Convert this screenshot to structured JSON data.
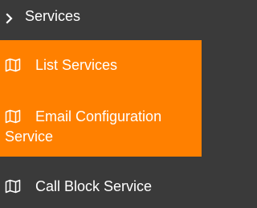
{
  "menu": {
    "section": {
      "label": "Services",
      "icon": "chevron-right-icon"
    },
    "items": [
      {
        "label": "List Services",
        "icon": "map-icon",
        "active": true
      },
      {
        "label": "Email Configuration Service",
        "icon": "map-icon",
        "active": true
      },
      {
        "label": "Call Block Service",
        "icon": "map-icon",
        "active": false
      }
    ]
  },
  "colors": {
    "background": "#3a3a3a",
    "accent": "#ff8000",
    "text": "#ffffff"
  }
}
